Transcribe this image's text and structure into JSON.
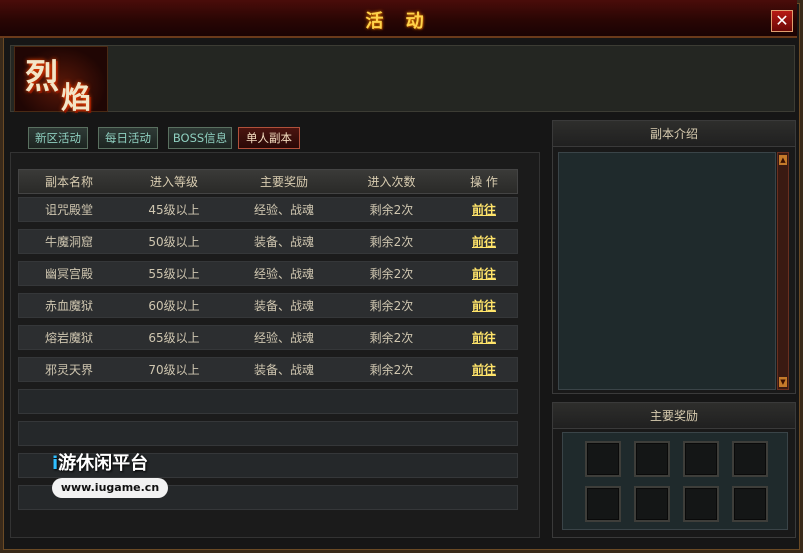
{
  "window": {
    "title": "活 动",
    "close_label": "✕"
  },
  "logo": {
    "char1": "烈",
    "char2": "焰"
  },
  "tabs": [
    {
      "label": "新区活动",
      "active": false
    },
    {
      "label": "每日活动",
      "active": false
    },
    {
      "label": "BOSS信息",
      "active": false
    },
    {
      "label": "单人副本",
      "active": true
    }
  ],
  "table": {
    "headers": [
      "副本名称",
      "进入等级",
      "主要奖励",
      "进入次数",
      "操 作"
    ],
    "rows": [
      {
        "name": "诅咒殿堂",
        "level": "45级以上",
        "reward": "经验、战魂",
        "count": "剩余2次",
        "action": "前往"
      },
      {
        "name": "牛魔洞窟",
        "level": "50级以上",
        "reward": "装备、战魂",
        "count": "剩余2次",
        "action": "前往"
      },
      {
        "name": "幽冥宫殿",
        "level": "55级以上",
        "reward": "经验、战魂",
        "count": "剩余2次",
        "action": "前往"
      },
      {
        "name": "赤血魔狱",
        "level": "60级以上",
        "reward": "装备、战魂",
        "count": "剩余2次",
        "action": "前往"
      },
      {
        "name": "熔岩魔狱",
        "level": "65级以上",
        "reward": "经验、战魂",
        "count": "剩余2次",
        "action": "前往"
      },
      {
        "name": "邪灵天界",
        "level": "70级以上",
        "reward": "装备、战魂",
        "count": "剩余2次",
        "action": "前往"
      }
    ]
  },
  "intro_panel": {
    "title": "副本介绍",
    "scroll_up": "▲",
    "scroll_down": "▼"
  },
  "reward_panel": {
    "title": "主要奖励"
  },
  "watermark": {
    "i": "i",
    "text": "游休闲平台",
    "url": "www.iugame.cn"
  }
}
